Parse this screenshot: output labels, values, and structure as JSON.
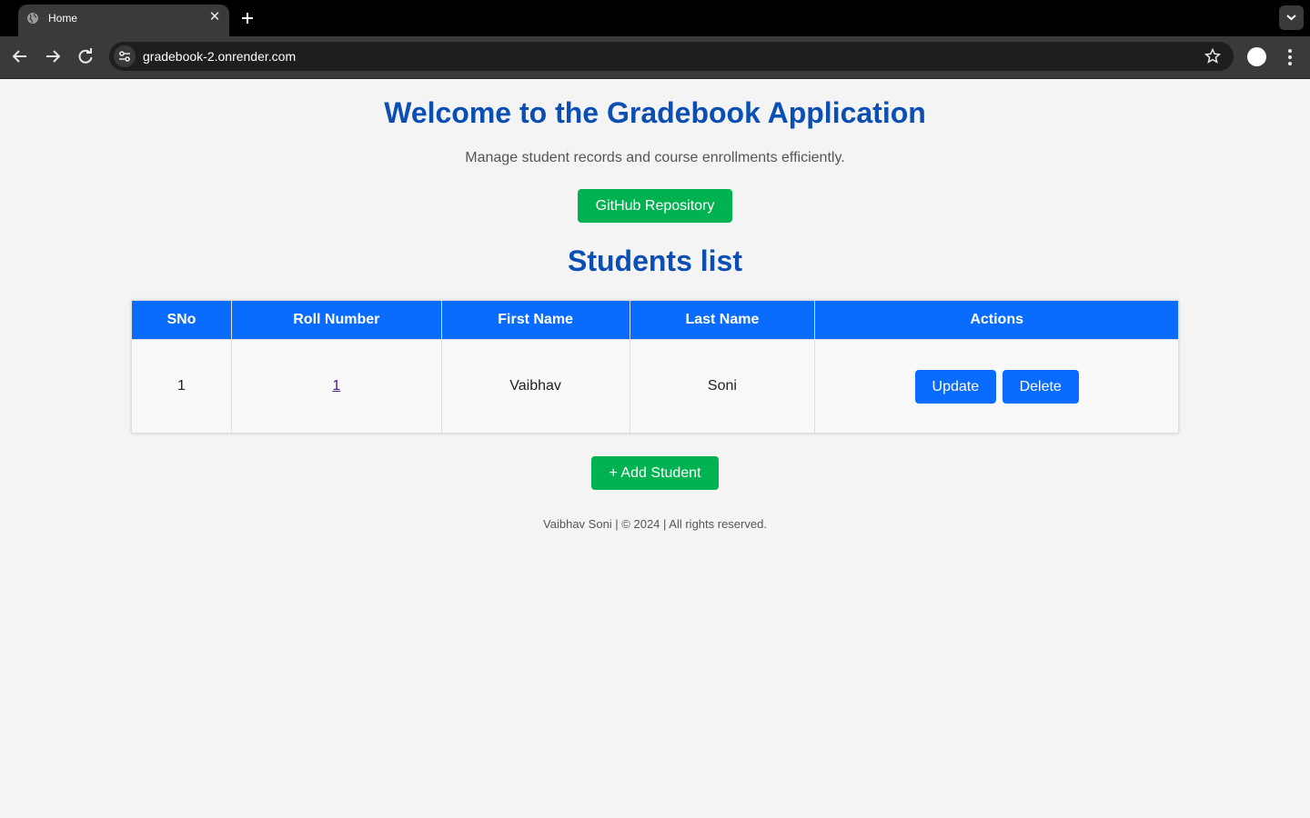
{
  "browser": {
    "tab_title": "Home",
    "url": "gradebook-2.onrender.com"
  },
  "page": {
    "title": "Welcome to the Gradebook Application",
    "subtitle": "Manage student records and course enrollments efficiently.",
    "github_button": "GitHub Repository",
    "list_title": "Students list",
    "add_button": "+ Add Student",
    "footer": "Vaibhav Soni | © 2024 | All rights reserved."
  },
  "table": {
    "headers": [
      "SNo",
      "Roll Number",
      "First Name",
      "Last Name",
      "Actions"
    ],
    "rows": [
      {
        "sno": "1",
        "roll": "1",
        "first": "Vaibhav",
        "last": "Soni",
        "update": "Update",
        "delete": "Delete"
      }
    ]
  },
  "colors": {
    "heading": "#0b4fb4",
    "table_header": "#0a6cff",
    "green_button": "#00b350"
  }
}
